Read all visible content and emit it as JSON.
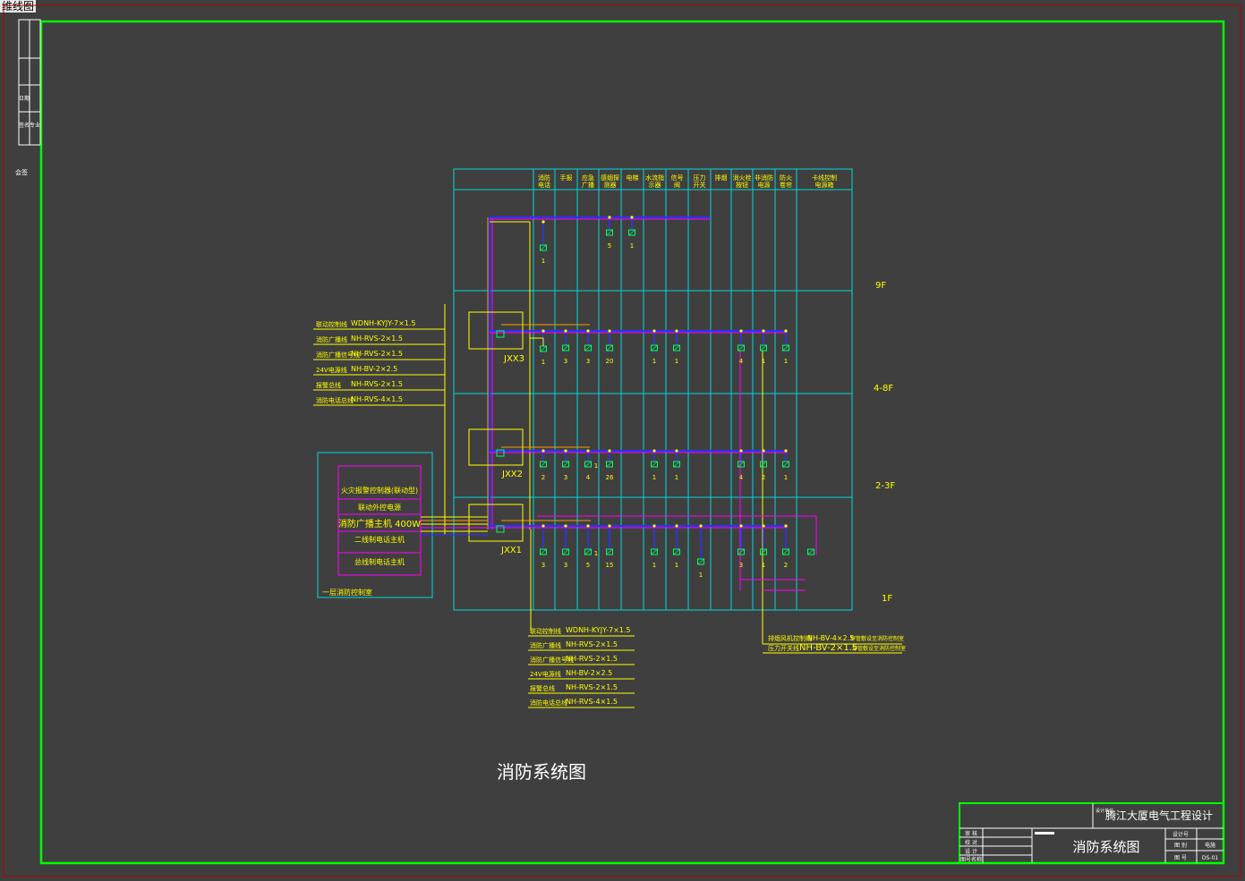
{
  "window": {
    "tab_label": "维线图"
  },
  "columns": [
    "消防电话",
    "手报",
    "应急广播",
    "感烟探测器",
    "电梯",
    "水流指示器",
    "信号阀",
    "压力开关",
    "排烟",
    "消火栓按钮",
    "非消防电源",
    "防火卷帘",
    "卡线控制电源箱"
  ],
  "floors": [
    "9F",
    "4-8F",
    "2-3F",
    "1F"
  ],
  "boxes": [
    "JXX3",
    "JXX2",
    "JXX1"
  ],
  "counts": {
    "f9": [
      "1",
      "5",
      "1"
    ],
    "f48": [
      "1",
      "3",
      "3",
      "20",
      "1",
      "1",
      "4",
      "1",
      "1"
    ],
    "f23": [
      "2",
      "3",
      "4",
      "1",
      "26",
      "1",
      "1",
      "4",
      "2",
      "1"
    ],
    "f1": [
      "3",
      "3",
      "5",
      "1",
      "15",
      "1",
      "1",
      "1",
      "3",
      "1",
      "2"
    ]
  },
  "left_cables": [
    {
      "name": "联动控制线",
      "spec": "WDNH-KYJY-7×1.5"
    },
    {
      "name": "消防广播线",
      "spec": "NH-RVS-2×1.5"
    },
    {
      "name": "消防广播信号线",
      "spec": "NH-RVS-2×1.5"
    },
    {
      "name": "24V电源线",
      "spec": "NH-BV-2×2.5"
    },
    {
      "name": "报警总线",
      "spec": "NH-RVS-2×1.5"
    },
    {
      "name": "消防电话总线",
      "spec": "NH-RVS-4×1.5"
    }
  ],
  "bottom_cables": [
    {
      "name": "联动控制线",
      "spec": "WDNH-KYJY-7×1.5"
    },
    {
      "name": "消防广播线",
      "spec": "NH-RVS-2×1.5"
    },
    {
      "name": "消防广播信号线",
      "spec": "NH-RVS-2×1.5"
    },
    {
      "name": "24V电源线",
      "spec": "NH-BV-2×2.5"
    },
    {
      "name": "报警总线",
      "spec": "NH-RVS-2×1.5"
    },
    {
      "name": "消防电话总线",
      "spec": "NH-RVS-4×1.5"
    }
  ],
  "right_notes": [
    {
      "name": "排烟风机控制线",
      "spec": "NH-BV-4×2.5",
      "note": "穿管敷设至消防控制室"
    },
    {
      "name": "压力开关线",
      "spec": "NH-BV-2×1.5",
      "note": "穿管敷设至消防控制室"
    }
  ],
  "control_room": {
    "label": "一层消防控制室",
    "items": [
      "火灾报警控制器(联动型)",
      "联动外控电源",
      "消防广播主机 400W",
      "二线制电话主机",
      "总线制电话主机"
    ]
  },
  "diagram_title": "消防系统图",
  "title_block": {
    "project_label": "设计单位",
    "project": "腾江大厦电气工程设计",
    "drawing": "消防系统图",
    "left_rows": [
      "审 核",
      "校 对",
      "设 计",
      "图号名称"
    ],
    "right_rows": [
      "设计号",
      "图 别",
      "图 号"
    ],
    "right_values": [
      "",
      "电施",
      "DS-01"
    ]
  },
  "margin_labels": [
    "会签",
    "日期",
    "签名",
    "专业"
  ],
  "colors": {
    "background": "#3f3f3f",
    "frame": "#00ff00",
    "grid": "#00d8d8",
    "text": "#ffff00",
    "bus_blue": "#3030ff",
    "bus_magenta": "#ff00ff",
    "wire_orange": "#ff9900",
    "symbol": "#00ff66",
    "border": "#c00000"
  }
}
